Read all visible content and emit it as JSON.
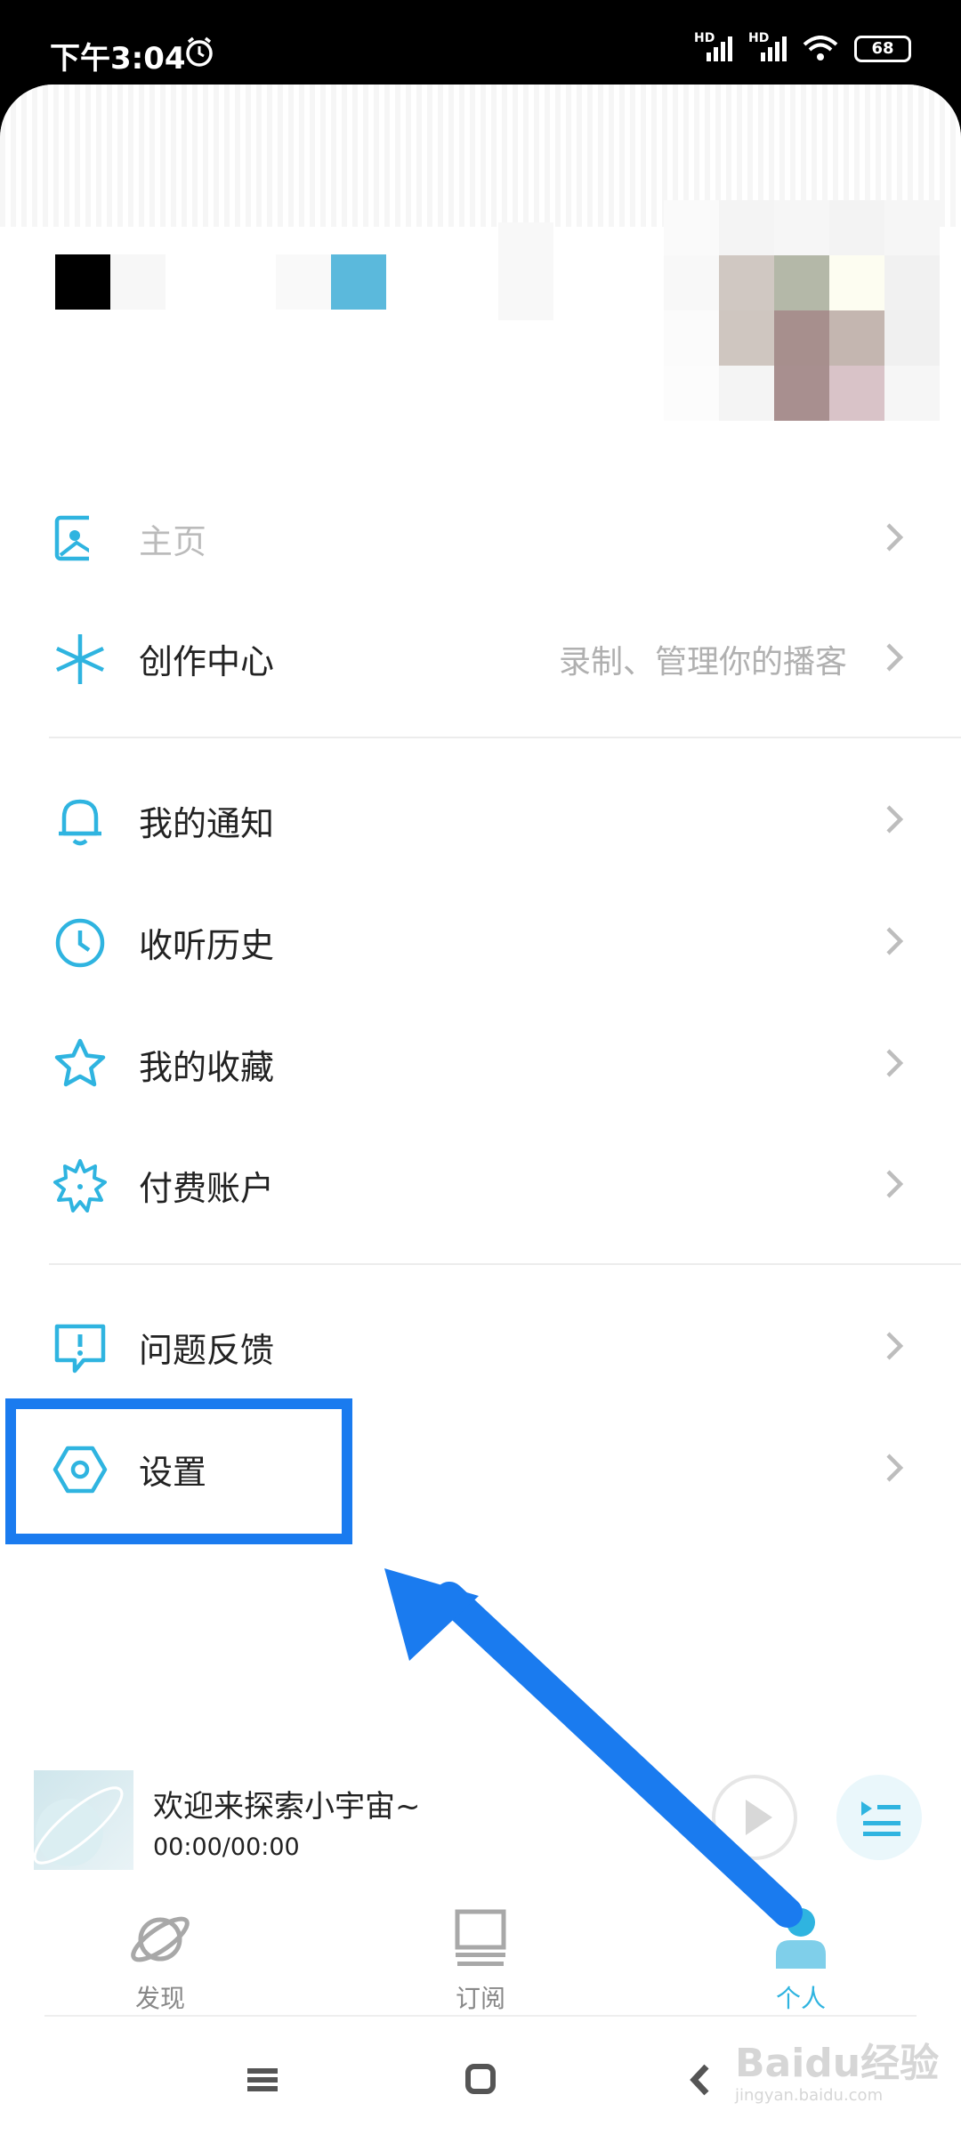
{
  "status_bar": {
    "time": "下午3:04",
    "signal1": "HD",
    "signal2": "HD",
    "battery": "68"
  },
  "menu": {
    "homepage_label": "主页",
    "creator_label": "创作中心",
    "creator_hint": "录制、管理你的播客",
    "notifications_label": "我的通知",
    "history_label": "收听历史",
    "favorites_label": "我的收藏",
    "paid_label": "付费账户",
    "feedback_label": "问题反馈",
    "settings_label": "设置"
  },
  "player": {
    "title": "欢迎来探索小宇宙~",
    "time": "00:00/00:00"
  },
  "tabs": [
    {
      "label": "发现",
      "icon": "planet-icon"
    },
    {
      "label": "订阅",
      "icon": "subscription-icon"
    },
    {
      "label": "个人",
      "icon": "person-icon",
      "active": true
    }
  ],
  "watermark": "Baidu经验",
  "watermark_url": "jingyan.baidu.com",
  "colors": {
    "accent": "#2fb4e0",
    "highlight": "#1a7bef"
  }
}
